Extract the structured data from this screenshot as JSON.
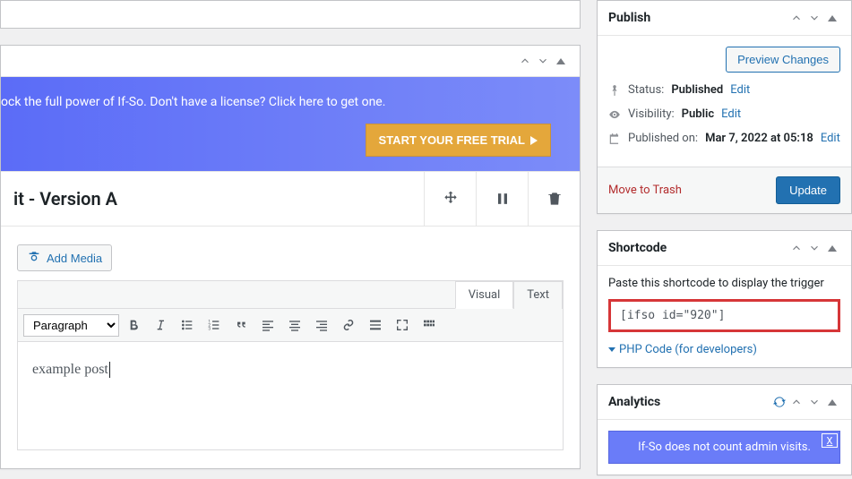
{
  "banner": {
    "text": "ock the full power of If-So. Don't have a license? Click here to get one.",
    "cta": "START YOUR FREE TRIAL"
  },
  "version": {
    "title": "it - Version A"
  },
  "editor": {
    "add_media": "Add Media",
    "tab_visual": "Visual",
    "tab_text": "Text",
    "paragraph": "Paragraph",
    "content": "example post"
  },
  "publish": {
    "title": "Publish",
    "preview": "Preview Changes",
    "status_label": "Status:",
    "status_value": "Published",
    "visibility_label": "Visibility:",
    "visibility_value": "Public",
    "published_label": "Published on:",
    "published_value": "Mar 7, 2022 at 05:18",
    "edit": "Edit",
    "trash": "Move to Trash",
    "update": "Update"
  },
  "shortcode": {
    "title": "Shortcode",
    "paste": "Paste this shortcode to display the trigger",
    "code": "[ifso id=\"920\"]",
    "php": "PHP Code (for developers)"
  },
  "analytics": {
    "title": "Analytics",
    "alert": "If-So does not count admin visits.",
    "close": "X"
  }
}
